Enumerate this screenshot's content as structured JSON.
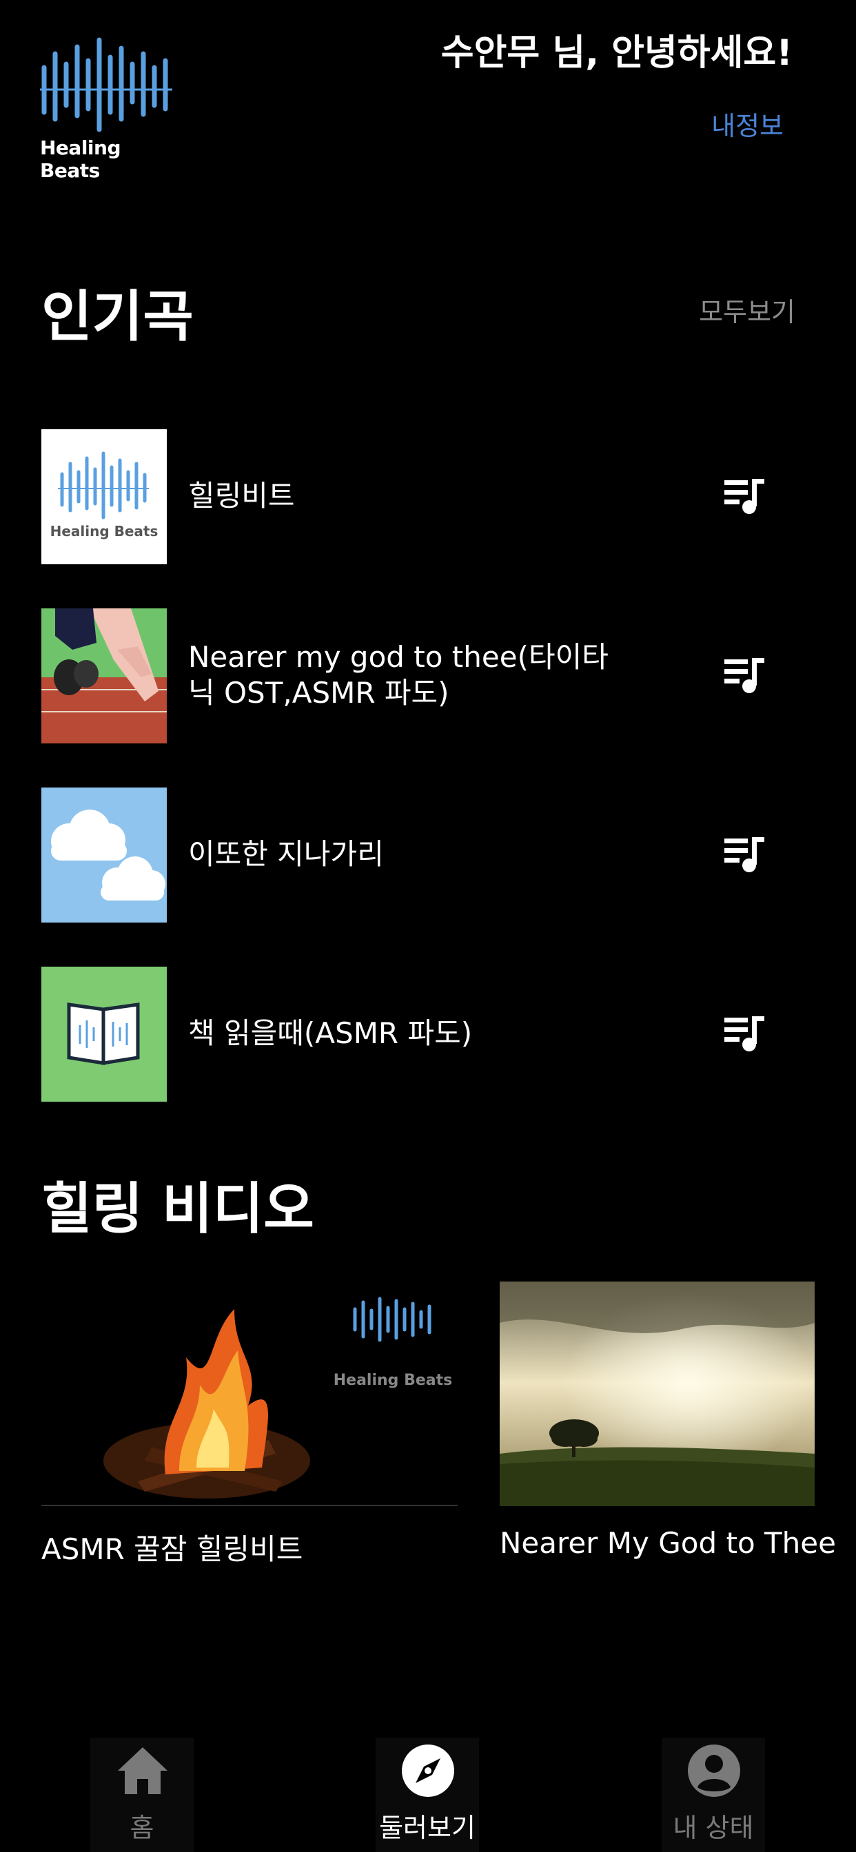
{
  "header": {
    "logo_text": "Healing Beats",
    "greeting": "수안무 님, 안녕하세요!",
    "my_info": "내정보"
  },
  "popular": {
    "title": "인기곡",
    "see_all": "모두보기",
    "songs": [
      {
        "title": "힐링비트",
        "thumb": "healing-beats-logo"
      },
      {
        "title": "Nearer my god to thee(타이타닉 OST,ASMR 파도)",
        "thumb": "runner-track"
      },
      {
        "title": "이또한 지나가리",
        "thumb": "clouds-sky"
      },
      {
        "title": "책 읽을때(ASMR 파도)",
        "thumb": "open-book"
      }
    ]
  },
  "videos": {
    "title": "힐링 비디오",
    "items": [
      {
        "title": "ASMR 꿀잠 힐링비트",
        "thumb_watermark": "Healing Beats"
      },
      {
        "title": "Nearer My God to Thee"
      }
    ]
  },
  "nav": {
    "home": "홈",
    "explore": "둘러보기",
    "status": "내 상태"
  },
  "colors": {
    "logo_blue": "#5aa0e0",
    "link_blue": "#4a84d8",
    "background": "#000000"
  }
}
